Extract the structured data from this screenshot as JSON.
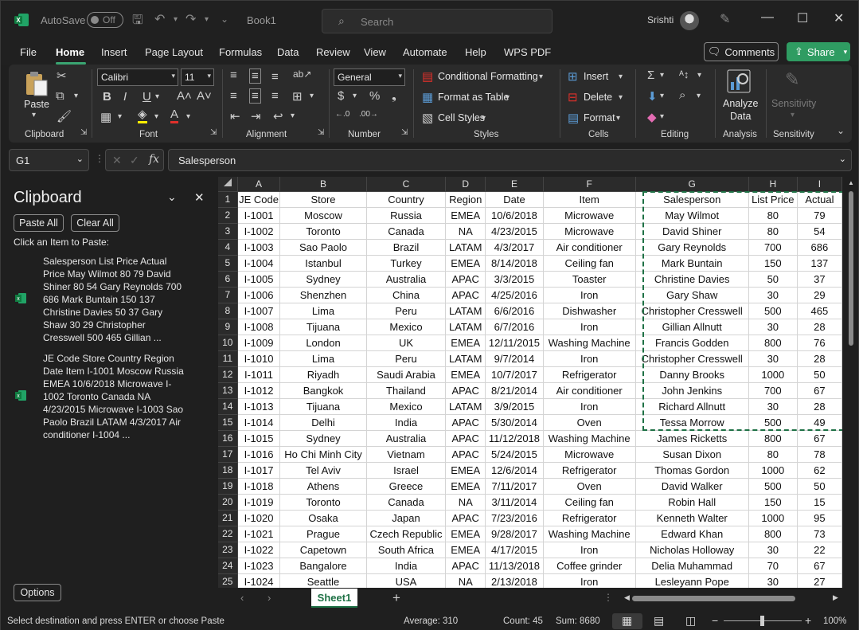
{
  "titlebar": {
    "autosave_label": "AutoSave",
    "autosave_state": "Off",
    "doc_title": "Book1",
    "search_placeholder": "Search",
    "user_name": "Srishti"
  },
  "menu": {
    "tabs": [
      "File",
      "Home",
      "Insert",
      "Page Layout",
      "Formulas",
      "Data",
      "Review",
      "View",
      "Automate",
      "Help",
      "WPS PDF"
    ],
    "active": "Home",
    "comments_label": "Comments",
    "share_label": "Share"
  },
  "ribbon": {
    "clipboard": {
      "paste": "Paste",
      "label": "Clipboard"
    },
    "font": {
      "name": "Calibri",
      "size": "11",
      "label": "Font"
    },
    "alignment": {
      "label": "Alignment"
    },
    "number": {
      "format": "General",
      "label": "Number"
    },
    "styles": {
      "conditional": "Conditional Formatting",
      "table": "Format as Table",
      "cell_styles": "Cell Styles",
      "label": "Styles"
    },
    "cells": {
      "insert": "Insert",
      "delete": "Delete",
      "format": "Format",
      "label": "Cells"
    },
    "editing": {
      "label": "Editing"
    },
    "analysis": {
      "analyze_line1": "Analyze",
      "analyze_line2": "Data",
      "label": "Analysis"
    },
    "sensitivity": {
      "button": "Sensitivity",
      "label": "Sensitivity"
    }
  },
  "formula_bar": {
    "name_box": "G1",
    "formula": "Salesperson"
  },
  "clipboard_pane": {
    "title": "Clipboard",
    "paste_all": "Paste All",
    "clear_all": "Clear All",
    "hint": "Click an Item to Paste:",
    "items": [
      "Salesperson List Price Actual Price May Wilmot 80 79 David Shiner 80 54 Gary Reynolds 700 686 Mark Buntain 150 137 Christine Davies 50 37 Gary Shaw 30 29 Christopher Cresswell 500 465 Gillian ...",
      "JE Code Store Country Region Date Item I-1001 Moscow Russia EMEA 10/6/2018 Microwave I-1002 Toronto Canada NA 4/23/2015 Microwave I-1003 Sao Paolo Brazil LATAM 4/3/2017 Air conditioner I-1004 ..."
    ],
    "options": "Options"
  },
  "sheet": {
    "columns": [
      "A",
      "B",
      "C",
      "D",
      "E",
      "F",
      "G",
      "H",
      "I"
    ],
    "rows": [
      [
        "JE Code",
        "Store",
        "Country",
        "Region",
        "Date",
        "Item",
        "Salesperson",
        "List Price",
        "Actual"
      ],
      [
        "I-1001",
        "Moscow",
        "Russia",
        "EMEA",
        "10/6/2018",
        "Microwave",
        "May Wilmot",
        "80",
        "79"
      ],
      [
        "I-1002",
        "Toronto",
        "Canada",
        "NA",
        "4/23/2015",
        "Microwave",
        "David Shiner",
        "80",
        "54"
      ],
      [
        "I-1003",
        "Sao Paolo",
        "Brazil",
        "LATAM",
        "4/3/2017",
        "Air conditioner",
        "Gary Reynolds",
        "700",
        "686"
      ],
      [
        "I-1004",
        "Istanbul",
        "Turkey",
        "EMEA",
        "8/14/2018",
        "Ceiling fan",
        "Mark Buntain",
        "150",
        "137"
      ],
      [
        "I-1005",
        "Sydney",
        "Australia",
        "APAC",
        "3/3/2015",
        "Toaster",
        "Christine Davies",
        "50",
        "37"
      ],
      [
        "I-1006",
        "Shenzhen",
        "China",
        "APAC",
        "4/25/2016",
        "Iron",
        "Gary Shaw",
        "30",
        "29"
      ],
      [
        "I-1007",
        "Lima",
        "Peru",
        "LATAM",
        "6/6/2016",
        "Dishwasher",
        "Christopher Cresswell",
        "500",
        "465"
      ],
      [
        "I-1008",
        "Tijuana",
        "Mexico",
        "LATAM",
        "6/7/2016",
        "Iron",
        "Gillian Allnutt",
        "30",
        "28"
      ],
      [
        "I-1009",
        "London",
        "UK",
        "EMEA",
        "12/11/2015",
        "Washing Machine",
        "Francis Godden",
        "800",
        "76"
      ],
      [
        "I-1010",
        "Lima",
        "Peru",
        "LATAM",
        "9/7/2014",
        "Iron",
        "Christopher Cresswell",
        "30",
        "28"
      ],
      [
        "I-1011",
        "Riyadh",
        "Saudi Arabia",
        "EMEA",
        "10/7/2017",
        "Refrigerator",
        "Danny Brooks",
        "1000",
        "50"
      ],
      [
        "I-1012",
        "Bangkok",
        "Thailand",
        "APAC",
        "8/21/2014",
        "Air conditioner",
        "John Jenkins",
        "700",
        "67"
      ],
      [
        "I-1013",
        "Tijuana",
        "Mexico",
        "LATAM",
        "3/9/2015",
        "Iron",
        "Richard Allnutt",
        "30",
        "28"
      ],
      [
        "I-1014",
        "Delhi",
        "India",
        "APAC",
        "5/30/2014",
        "Oven",
        "Tessa Morrow",
        "500",
        "49"
      ],
      [
        "I-1015",
        "Sydney",
        "Australia",
        "APAC",
        "11/12/2018",
        "Washing Machine",
        "James Ricketts",
        "800",
        "67"
      ],
      [
        "I-1016",
        "Ho Chi Minh City",
        "Vietnam",
        "APAC",
        "5/24/2015",
        "Microwave",
        "Susan Dixon",
        "80",
        "78"
      ],
      [
        "I-1017",
        "Tel Aviv",
        "Israel",
        "EMEA",
        "12/6/2014",
        "Refrigerator",
        "Thomas Gordon",
        "1000",
        "62"
      ],
      [
        "I-1018",
        "Athens",
        "Greece",
        "EMEA",
        "7/11/2017",
        "Oven",
        "David Walker",
        "500",
        "50"
      ],
      [
        "I-1019",
        "Toronto",
        "Canada",
        "NA",
        "3/11/2014",
        "Ceiling fan",
        "Robin Hall",
        "150",
        "15"
      ],
      [
        "I-1020",
        "Osaka",
        "Japan",
        "APAC",
        "7/23/2016",
        "Refrigerator",
        "Kenneth Walter",
        "1000",
        "95"
      ],
      [
        "I-1021",
        "Prague",
        "Czech Republic",
        "EMEA",
        "9/28/2017",
        "Washing Machine",
        "Edward Khan",
        "800",
        "73"
      ],
      [
        "I-1022",
        "Capetown",
        "South Africa",
        "EMEA",
        "4/17/2015",
        "Iron",
        "Nicholas Holloway",
        "30",
        "22"
      ],
      [
        "I-1023",
        "Bangalore",
        "India",
        "APAC",
        "11/13/2018",
        "Coffee grinder",
        "Delia Muhammad",
        "70",
        "67"
      ],
      [
        "I-1024",
        "Seattle",
        "USA",
        "NA",
        "2/13/2018",
        "Iron",
        "Lesleyann Pope",
        "30",
        "27"
      ]
    ],
    "active_tab": "Sheet1"
  },
  "statusbar": {
    "message": "Select destination and press ENTER or choose Paste",
    "average": "Average: 310",
    "count": "Count: 45",
    "sum": "Sum: 8680",
    "zoom": "100%"
  },
  "colors": {
    "accent_green": "#1e7145",
    "share_green": "#2f9c62",
    "dark_bg": "#1f1f1f",
    "ribbon_bg": "#2b2b2b"
  }
}
